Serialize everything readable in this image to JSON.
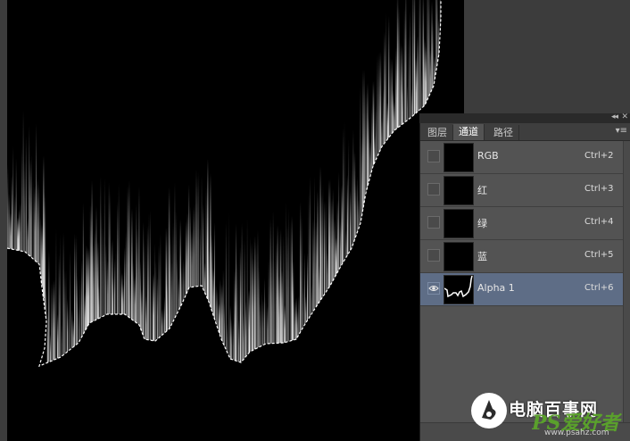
{
  "panel": {
    "tabs": [
      {
        "label": "图层",
        "active": false
      },
      {
        "label": "通道",
        "active": true
      },
      {
        "label": "路径",
        "active": false
      }
    ],
    "channels": [
      {
        "name": "RGB",
        "shortcut": "Ctrl+2",
        "visible": false,
        "selected": false
      },
      {
        "name": "红",
        "shortcut": "Ctrl+3",
        "visible": false,
        "selected": false
      },
      {
        "name": "绿",
        "shortcut": "Ctrl+4",
        "visible": false,
        "selected": false
      },
      {
        "name": "蓝",
        "shortcut": "Ctrl+5",
        "visible": false,
        "selected": false
      },
      {
        "name": "Alpha 1",
        "shortcut": "Ctrl+6",
        "visible": true,
        "selected": true
      }
    ],
    "icons": {
      "collapse": "double-chevron-left-icon",
      "close": "close-icon",
      "menu": "panel-menu-icon",
      "eye": "eye-icon"
    }
  },
  "watermark": {
    "title": "电脑百事网",
    "logo_text": "PS爱好者",
    "url": "www.psahz.com"
  },
  "colors": {
    "panel_bg": "#535353",
    "selected_row": "#5e6d86",
    "document_bg": "#000000",
    "selection_white": "#ffffff"
  }
}
